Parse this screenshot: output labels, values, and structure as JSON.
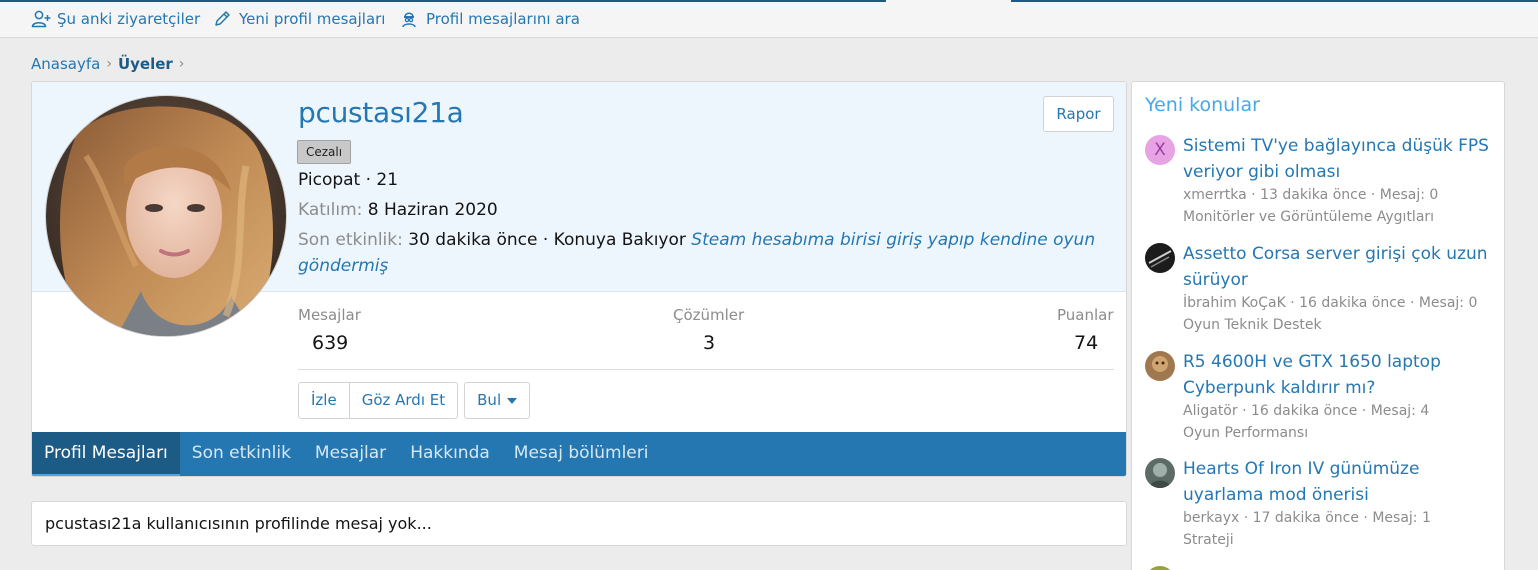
{
  "subnav": {
    "items": [
      {
        "label": "Şu anki ziyaretçiler",
        "icon": "user-plus-icon"
      },
      {
        "label": "Yeni profil mesajları",
        "icon": "pencil-icon"
      },
      {
        "label": "Profil mesajlarını ara",
        "icon": "user-search-icon"
      }
    ]
  },
  "breadcrumb": {
    "home": "Anasayfa",
    "current": "Üyeler"
  },
  "profile": {
    "username": "pcustası21a",
    "badge": "Cezalı",
    "title_line": "Picopat · 21",
    "joined_label": "Katılım:",
    "joined_value": "8 Haziran 2020",
    "activity_label": "Son etkinlik:",
    "activity_value": "30 dakika önce · Konuya Bakıyor",
    "activity_thread_line1": "Steam hesabıma birisi giriş yapıp kendine oyun",
    "activity_thread_line2": "göndermiş",
    "report_label": "Rapor",
    "stats": {
      "messages_label": "Mesajlar",
      "messages_value": "639",
      "solutions_label": "Çözümler",
      "solutions_value": "3",
      "points_label": "Puanlar",
      "points_value": "74"
    },
    "buttons": {
      "follow": "İzle",
      "ignore": "Göz Ardı Et",
      "find": "Bul"
    },
    "tabs": [
      "Profil Mesajları",
      "Son etkinlik",
      "Mesajlar",
      "Hakkında",
      "Mesaj bölümleri"
    ],
    "empty_message": "pcustası21a kullanıcısının profilinde mesaj yok..."
  },
  "sidebar": {
    "title": "Yeni konular",
    "threads": [
      {
        "avatar_letter": "X",
        "title_line1": "Sistemi TV'ye bağlayınca düşük FPS",
        "title_line2": "veriyor gibi olması",
        "meta": "xmerrtka · 13 dakika önce · Mesaj: 0",
        "forum": "Monitörler ve Görüntüleme Aygıtları"
      },
      {
        "title_line1": "Assetto Corsa server girişi çok uzun",
        "title_line2": "sürüyor",
        "meta": "İbrahim KoÇaK · 16 dakika önce · Mesaj: 0",
        "forum": "Oyun Teknik Destek"
      },
      {
        "title_line1": "R5 4600H ve GTX 1650 laptop",
        "title_line2": "Cyberpunk kaldırır mı?",
        "meta": "Aligatör · 16 dakika önce · Mesaj: 4",
        "forum": "Oyun Performansı"
      },
      {
        "title_line1": "Hearts Of Iron IV günümüze",
        "title_line2": "uyarlama mod önerisi",
        "meta": "berkayx · 17 dakika önce · Mesaj: 1",
        "forum": "Strateji"
      }
    ]
  },
  "colors": {
    "link": "#2577b1",
    "tab_bar": "#2577b1",
    "tab_active": "#1d5b87",
    "sidebar_title": "#47a7eb",
    "muted": "#8c8c8c"
  }
}
